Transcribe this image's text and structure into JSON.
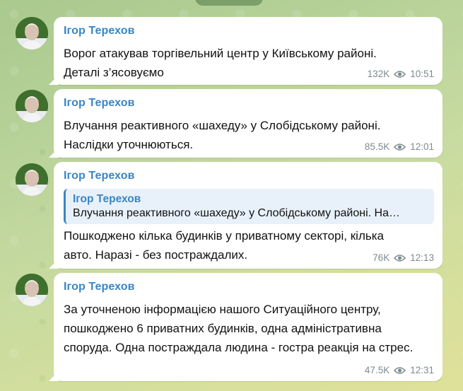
{
  "channel_author": "Ігор Терехов",
  "messages": [
    {
      "sender": "Ігор Терехов",
      "lines": [
        "Ворог атакував торгівельний центр у Київському районі.",
        "Деталі з’ясовуємо"
      ],
      "views": "132K",
      "time": "10:51"
    },
    {
      "sender": "Ігор Терехов",
      "lines": [
        "Влучання реактивного «шахеду» у Слобідському районі.",
        "Наслідки уточнюються."
      ],
      "views": "85.5K",
      "time": "12:01"
    },
    {
      "sender": "Ігор Терехов",
      "reply": {
        "sender": "Ігор Терехов",
        "text": "Влучання реактивного «шахеду» у Слобідському районі. На…"
      },
      "lines": [
        "Пошкоджено кілька будинків у приватному секторі, кілька",
        "авто. Наразі - без постраждалих."
      ],
      "views": "76K",
      "time": "12:13"
    },
    {
      "sender": "Ігор Терехов",
      "lines": [
        "За уточненою інформацією нашого Ситуаційного центру,",
        "пошкоджено 6 приватних будинків, одна адміністративна",
        "споруда. Одна постраждала людина - гостра реакція на стрес."
      ],
      "views": "47.5K",
      "time": "12:31"
    }
  ],
  "icons": {
    "views": "eye-icon"
  },
  "colors": {
    "sender": "#3a85c4",
    "meta": "#7e8a8e",
    "bubble": "#ffffff"
  }
}
